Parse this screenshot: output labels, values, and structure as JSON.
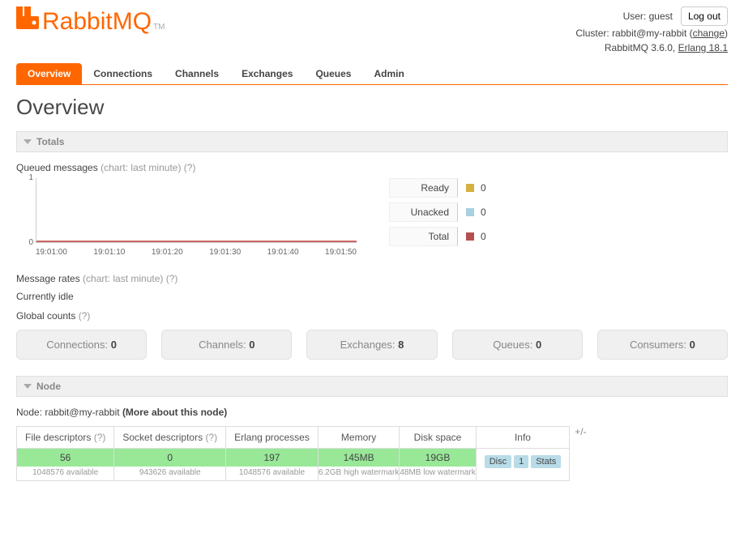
{
  "header": {
    "brand": "RabbitMQ",
    "user_label": "User:",
    "user_value": "guest",
    "cluster_label": "Cluster:",
    "cluster_value": "rabbit@my-rabbit",
    "change_text": "change",
    "version_prefix": "RabbitMQ 3.6.0,",
    "erlang_text": "Erlang 18.1",
    "logout": "Log out"
  },
  "tabs": [
    "Overview",
    "Connections",
    "Channels",
    "Exchanges",
    "Queues",
    "Admin"
  ],
  "page_title": "Overview",
  "totals": {
    "title": "Totals",
    "queued_label": "Queued messages",
    "chart_hint": "(chart: last minute)",
    "help": "(?)",
    "rates_label": "Message rates",
    "idle_text": "Currently idle",
    "global_counts_label": "Global counts"
  },
  "chart_data": {
    "type": "line",
    "title": "Queued messages (last minute)",
    "xlabel": "",
    "ylabel": "",
    "ylim": [
      0.0,
      1.0
    ],
    "x_ticks": [
      "19:01:00",
      "19:01:10",
      "19:01:20",
      "19:01:30",
      "19:01:40",
      "19:01:50"
    ],
    "series": [
      {
        "name": "Ready",
        "color": "#d4b13f",
        "latest": 0,
        "values": [
          0,
          0,
          0,
          0,
          0,
          0
        ]
      },
      {
        "name": "Unacked",
        "color": "#a8d0e0",
        "latest": 0,
        "values": [
          0,
          0,
          0,
          0,
          0,
          0
        ]
      },
      {
        "name": "Total",
        "color": "#b55050",
        "latest": 0,
        "values": [
          0,
          0,
          0,
          0,
          0,
          0
        ]
      }
    ]
  },
  "counts": [
    {
      "label": "Connections:",
      "value": "0"
    },
    {
      "label": "Channels:",
      "value": "0"
    },
    {
      "label": "Exchanges:",
      "value": "8"
    },
    {
      "label": "Queues:",
      "value": "0"
    },
    {
      "label": "Consumers:",
      "value": "0"
    }
  ],
  "node": {
    "title": "Node",
    "node_label": "Node:",
    "node_name": "rabbit@my-rabbit",
    "more_link": "(More about this node)",
    "plusminus": "+/-",
    "cols": [
      {
        "header": "File descriptors",
        "help": "(?)",
        "value": "56",
        "sub": "1048576 available"
      },
      {
        "header": "Socket descriptors",
        "help": "(?)",
        "value": "0",
        "sub": "943626 available"
      },
      {
        "header": "Erlang processes",
        "help": "",
        "value": "197",
        "sub": "1048576 available"
      },
      {
        "header": "Memory",
        "help": "",
        "value": "145MB",
        "sub": "6.2GB high watermark"
      },
      {
        "header": "Disk space",
        "help": "",
        "value": "19GB",
        "sub": "48MB low watermark"
      }
    ],
    "info_header": "Info",
    "info_badges": [
      "Disc",
      "1",
      "Stats"
    ]
  }
}
